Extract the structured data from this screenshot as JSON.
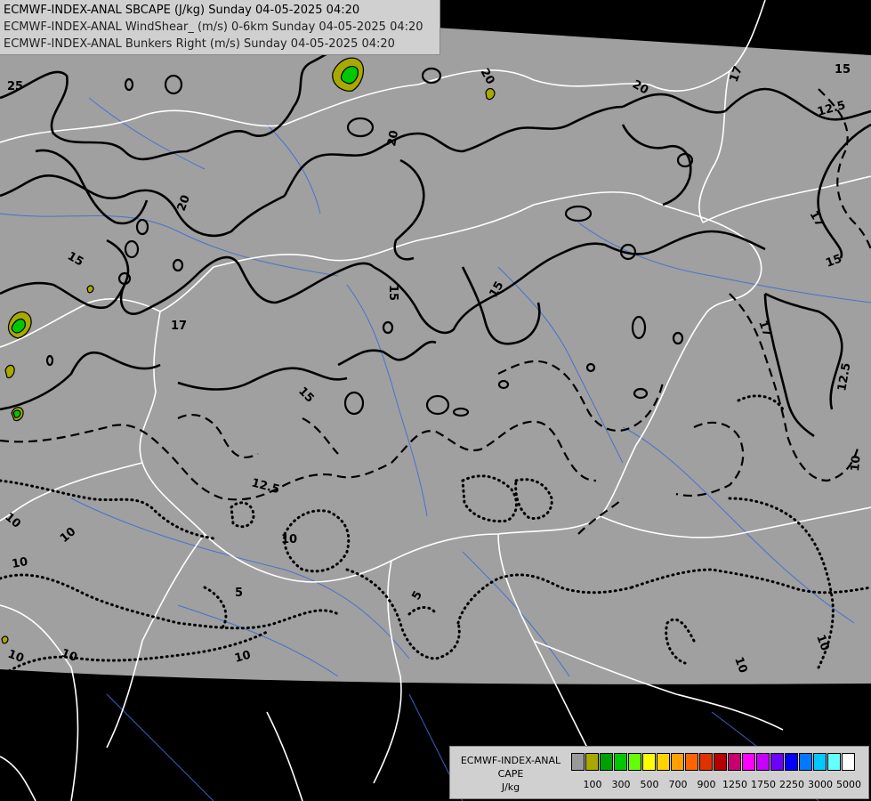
{
  "title_lines": [
    "ECMWF-INDEX-ANAL SBCAPE (J/kg) Sunday 04-05-2025 04:20",
    "ECMWF-INDEX-ANAL WindShear_ (m/s) 0-6km Sunday 04-05-2025 04:20",
    "ECMWF-INDEX-ANAL Bunkers Right (m/s) Sunday 04-05-2025 04:20"
  ],
  "legend": {
    "title_lines": [
      "ECMWF-INDEX-ANAL",
      "CAPE",
      "J/kg"
    ],
    "colors": [
      "#9a9a9a",
      "#a8a800",
      "#00a000",
      "#00c800",
      "#64ff00",
      "#ffff00",
      "#ffd200",
      "#ffa000",
      "#ff6400",
      "#e03200",
      "#b40000",
      "#c8006e",
      "#ff00ff",
      "#c800ff",
      "#6e00ff",
      "#0000ff",
      "#0078ff",
      "#00c8ff",
      "#64ffff",
      "#ffffff"
    ],
    "tick_labels": [
      "100",
      "300",
      "500",
      "700",
      "900",
      "1250",
      "1750",
      "2250",
      "3000",
      "5000"
    ]
  },
  "contour_labels": [
    "25",
    "20",
    "20",
    "20",
    "20",
    "17",
    "15",
    "12.5",
    "15",
    "15",
    "17",
    "15",
    "17",
    "17",
    "15",
    "15",
    "12.5",
    "12.5",
    "10",
    "10",
    "10",
    "10",
    "10",
    "10",
    "10",
    "5",
    "5",
    "10",
    "10",
    "10"
  ],
  "map_colors": {
    "field": "#a0a0a0",
    "outside": "#000000",
    "border": "#ffffff",
    "river": "#3c6fd0",
    "contour": "#000000"
  }
}
